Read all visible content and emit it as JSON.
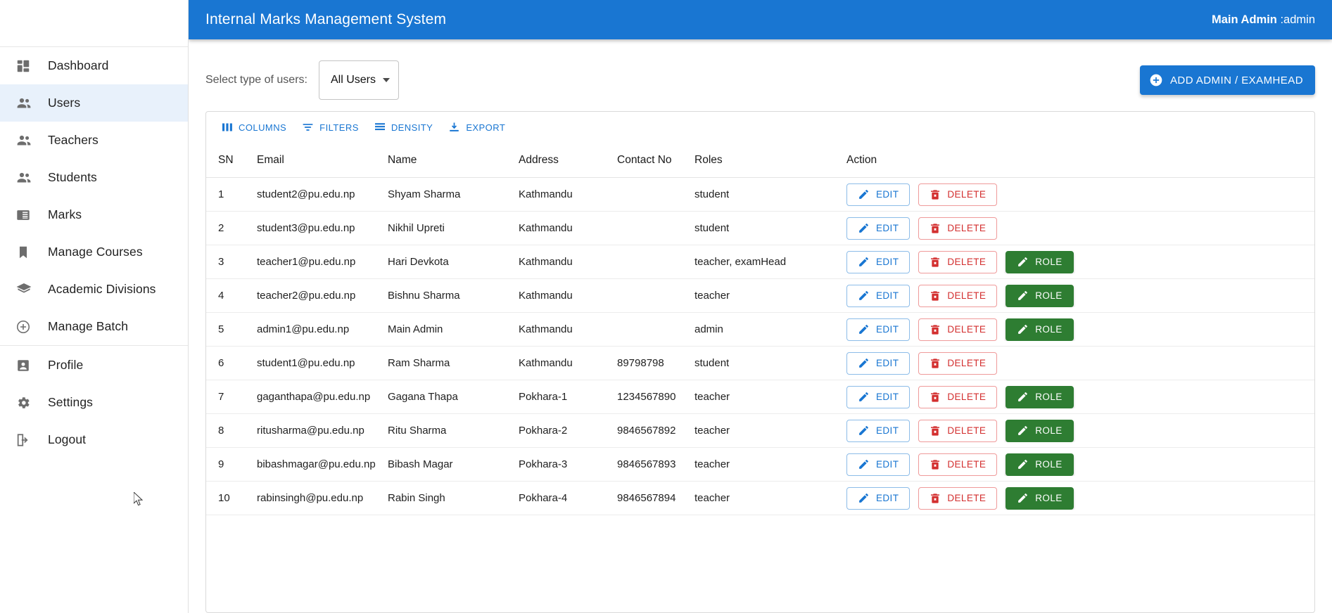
{
  "app": {
    "title": "Internal Marks Management System",
    "user": {
      "name": "Main Admin",
      "role": " :admin"
    }
  },
  "sidebar": {
    "groups": [
      {
        "items": [
          {
            "label": "Dashboard",
            "icon": "dashboard-icon",
            "active": false
          },
          {
            "label": "Users",
            "icon": "users-icon",
            "active": true
          },
          {
            "label": "Teachers",
            "icon": "users-icon",
            "active": false
          },
          {
            "label": "Students",
            "icon": "users-icon",
            "active": false
          },
          {
            "label": "Marks",
            "icon": "marks-icon",
            "active": false
          },
          {
            "label": "Manage Courses",
            "icon": "bookmark-icon",
            "active": false
          },
          {
            "label": "Academic Divisions",
            "icon": "graduation-cap-icon",
            "active": false
          },
          {
            "label": "Manage Batch",
            "icon": "plus-circle-icon",
            "active": false
          }
        ]
      },
      {
        "items": [
          {
            "label": "Profile",
            "icon": "person-box-icon",
            "active": false
          },
          {
            "label": "Settings",
            "icon": "gear-icon",
            "active": false
          },
          {
            "label": "Logout",
            "icon": "logout-icon",
            "active": false
          }
        ]
      }
    ]
  },
  "filter": {
    "label": "Select type of users:",
    "select_value": "All Users",
    "options": [
      "All Users"
    ],
    "add_button": "ADD ADMIN / EXAMHEAD"
  },
  "grid": {
    "toolbar": [
      {
        "label": "COLUMNS",
        "icon": "columns-icon"
      },
      {
        "label": "FILTERS",
        "icon": "filter-icon"
      },
      {
        "label": "DENSITY",
        "icon": "density-icon"
      },
      {
        "label": "EXPORT",
        "icon": "download-icon"
      }
    ],
    "columns": [
      "SN",
      "Email",
      "Name",
      "Address",
      "Contact No",
      "Roles",
      "Action"
    ],
    "actions": {
      "edit": "EDIT",
      "delete": "DELETE",
      "role": "ROLE"
    },
    "rows": [
      {
        "sn": "1",
        "email": "student2@pu.edu.np",
        "name": "Shyam Sharma",
        "address": "Kathmandu",
        "contact": "",
        "roles": "student",
        "has_role": false
      },
      {
        "sn": "2",
        "email": "student3@pu.edu.np",
        "name": "Nikhil Upreti",
        "address": "Kathmandu",
        "contact": "",
        "roles": "student",
        "has_role": false
      },
      {
        "sn": "3",
        "email": "teacher1@pu.edu.np",
        "name": "Hari Devkota",
        "address": "Kathmandu",
        "contact": "",
        "roles": "teacher, examHead",
        "has_role": true
      },
      {
        "sn": "4",
        "email": "teacher2@pu.edu.np",
        "name": "Bishnu Sharma",
        "address": "Kathmandu",
        "contact": "",
        "roles": "teacher",
        "has_role": true
      },
      {
        "sn": "5",
        "email": "admin1@pu.edu.np",
        "name": "Main Admin",
        "address": "Kathmandu",
        "contact": "",
        "roles": "admin",
        "has_role": true
      },
      {
        "sn": "6",
        "email": "student1@pu.edu.np",
        "name": "Ram Sharma",
        "address": "Kathmandu",
        "contact": "89798798",
        "roles": "student",
        "has_role": false
      },
      {
        "sn": "7",
        "email": "gaganthapa@pu.edu.np",
        "name": "Gagana Thapa",
        "address": "Pokhara-1",
        "contact": "1234567890",
        "roles": "teacher",
        "has_role": true
      },
      {
        "sn": "8",
        "email": "ritusharma@pu.edu.np",
        "name": "Ritu Sharma",
        "address": "Pokhara-2",
        "contact": "9846567892",
        "roles": "teacher",
        "has_role": true
      },
      {
        "sn": "9",
        "email": "bibashmagar@pu.edu.np",
        "name": "Bibash Magar",
        "address": "Pokhara-3",
        "contact": "9846567893",
        "roles": "teacher",
        "has_role": true
      },
      {
        "sn": "10",
        "email": "rabinsingh@pu.edu.np",
        "name": "Rabin Singh",
        "address": "Pokhara-4",
        "contact": "9846567894",
        "roles": "teacher",
        "has_role": true
      }
    ]
  },
  "colors": {
    "primary": "#1976d2",
    "danger": "#d32f2f",
    "success": "#2e7d32",
    "active_nav_bg": "#e8f1fb"
  }
}
